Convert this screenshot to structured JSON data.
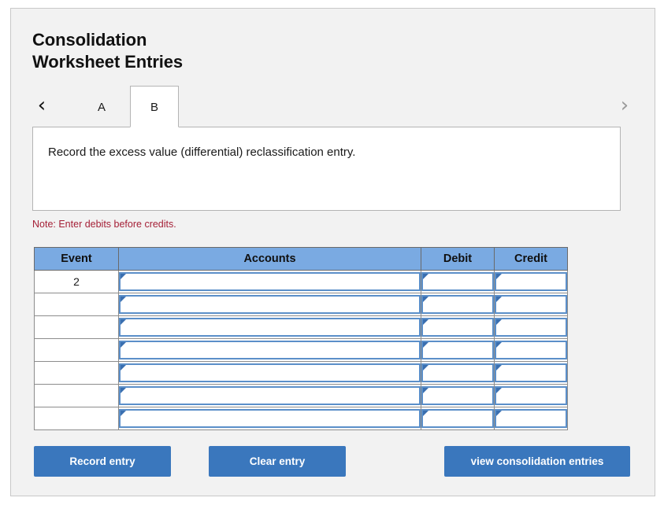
{
  "page": {
    "title": "Consolidation\nWorksheet Entries"
  },
  "tabs": {
    "prev_icon": "chevron-left-icon",
    "next_icon": "chevron-right-icon",
    "prev_glyph": "‹",
    "next_glyph": "›",
    "items": [
      {
        "label": "A",
        "active": false
      },
      {
        "label": "B",
        "active": true
      }
    ]
  },
  "instruction": {
    "text": "Record the excess value (differential) reclassification entry."
  },
  "note": {
    "text": "Note: Enter debits before credits."
  },
  "journal": {
    "columns": [
      "Event",
      "Accounts",
      "Debit",
      "Credit"
    ],
    "rows": [
      {
        "event": "2",
        "account": "",
        "debit": "",
        "credit": ""
      },
      {
        "event": "",
        "account": "",
        "debit": "",
        "credit": ""
      },
      {
        "event": "",
        "account": "",
        "debit": "",
        "credit": ""
      },
      {
        "event": "",
        "account": "",
        "debit": "",
        "credit": ""
      },
      {
        "event": "",
        "account": "",
        "debit": "",
        "credit": ""
      },
      {
        "event": "",
        "account": "",
        "debit": "",
        "credit": ""
      },
      {
        "event": "",
        "account": "",
        "debit": "",
        "credit": ""
      }
    ]
  },
  "buttons": {
    "record": "Record entry",
    "clear": "Clear entry",
    "view": "view consolidation entries"
  },
  "colors": {
    "panel_bg": "#f2f2f2",
    "button_blue": "#3a77bd",
    "header_blue": "#7aaae2",
    "input_border_blue": "#5b8fc9",
    "marker_blue": "#3a6fb0",
    "note_red": "#a52037"
  }
}
